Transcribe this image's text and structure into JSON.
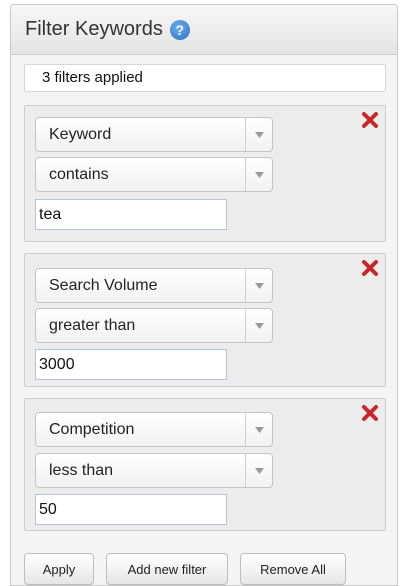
{
  "panel": {
    "title": "Filter Keywords",
    "help_icon": "question-circle-icon",
    "status": "3 filters applied"
  },
  "filters": [
    {
      "field": "Keyword",
      "operator": "contains",
      "value": "tea",
      "remove_icon": "red-x-icon"
    },
    {
      "field": "Search Volume",
      "operator": "greater than",
      "value": "3000",
      "remove_icon": "red-x-icon"
    },
    {
      "field": "Competition",
      "operator": "less than",
      "value": "50",
      "remove_icon": "red-x-icon"
    }
  ],
  "buttons": {
    "apply": "Apply",
    "add_filter": "Add new filter",
    "remove_all": "Remove All"
  },
  "colors": {
    "help_icon": "#2b73c2",
    "remove_icon": "#c8262b"
  }
}
